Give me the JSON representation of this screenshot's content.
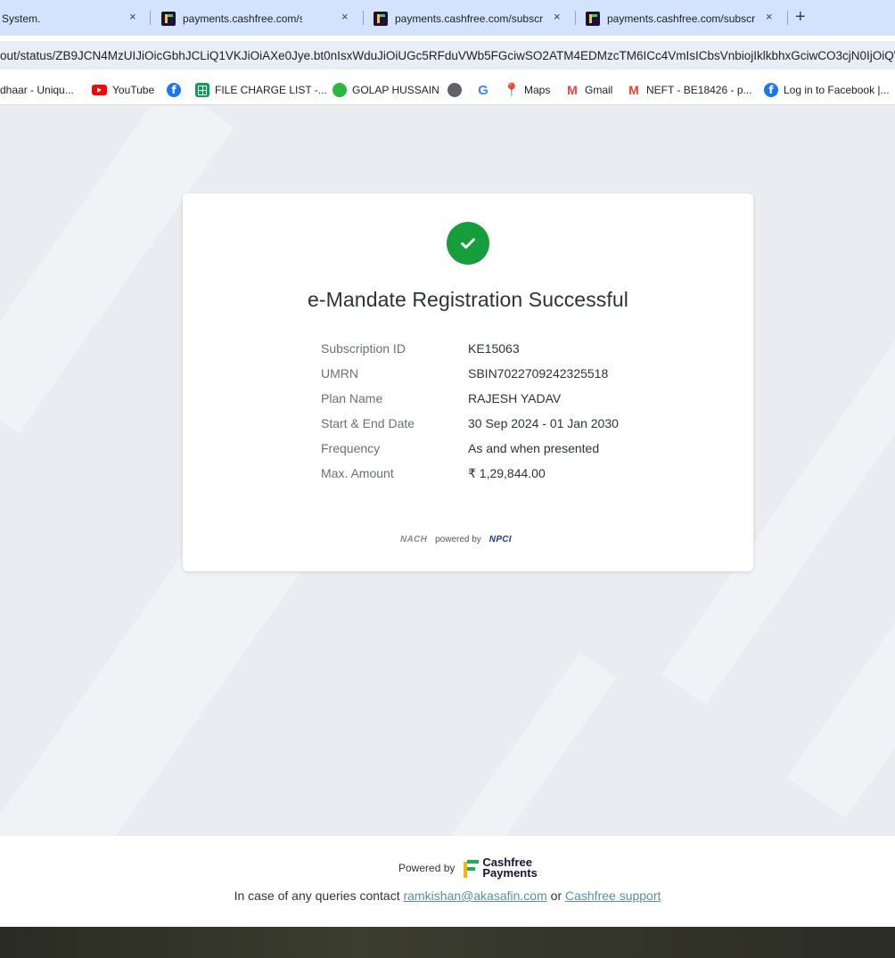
{
  "browser": {
    "tabs": [
      {
        "title": "System.",
        "close": "×"
      },
      {
        "title": "payments.cashfree.com/subscri",
        "close": "×"
      },
      {
        "title": "payments.cashfree.com/subscri",
        "close": "×"
      },
      {
        "title": "payments.cashfree.com/subscri",
        "close": "×"
      }
    ],
    "new_tab": "+",
    "url": "out/status/ZB9JCN4MzUIJiOicGbhJCLiQ1VKJiOiAXe0Jye.bt0nIsxWduJiOiUGc5RFduVWb5FGciwSO2ATM4EDMzcTM6ICc4VmIsICbsVnbiojIklkbhxGciwCO3cjN0IjOiQWS"
  },
  "bookmarks": [
    {
      "label": "dhaar - Uniqu...",
      "icon": "aadhaar-icon"
    },
    {
      "label": "YouTube",
      "icon": "youtube-icon"
    },
    {
      "label": "",
      "icon": "facebook-icon"
    },
    {
      "label": "FILE CHARGE LIST -...",
      "icon": "sheets-icon"
    },
    {
      "label": "GOLAP HUSSAIN",
      "icon": "whatsapp-icon"
    },
    {
      "label": "",
      "icon": "globe-icon"
    },
    {
      "label": "",
      "icon": "google-icon"
    },
    {
      "label": "Maps",
      "icon": "maps-icon"
    },
    {
      "label": "Gmail",
      "icon": "gmail-icon"
    },
    {
      "label": "NEFT - BE18426 - p...",
      "icon": "gmail-icon"
    },
    {
      "label": "Log in to Facebook |...",
      "icon": "facebook-icon"
    }
  ],
  "card": {
    "title": "e-Mandate Registration Successful",
    "details": [
      {
        "label": "Subscription ID",
        "value": "KE15063"
      },
      {
        "label": "UMRN",
        "value": "SBIN7022709242325518"
      },
      {
        "label": "Plan Name",
        "value": "RAJESH YADAV"
      },
      {
        "label": "Start & End Date",
        "value": "30 Sep 2024 - 01 Jan 2030"
      },
      {
        "label": "Frequency",
        "value": "As and when presented"
      },
      {
        "label": "Max. Amount",
        "value": "₹ 1,29,844.00"
      }
    ],
    "nach_logo": "NACH",
    "powered_by": "powered by",
    "npci_logo": "NPCI"
  },
  "footer": {
    "powered_by": "Powered by",
    "brand_line1": "Cashfree",
    "brand_line2": "Payments",
    "query_prefix": "In case of any queries contact",
    "email": "ramkishan@akasafin.com",
    "or": "or",
    "support": "Cashfree support"
  },
  "colors": {
    "success": "#179e3c",
    "link": "#5b8ca6",
    "page_bg": "#eaecf1",
    "tabstrip": "#d3e3fd"
  }
}
